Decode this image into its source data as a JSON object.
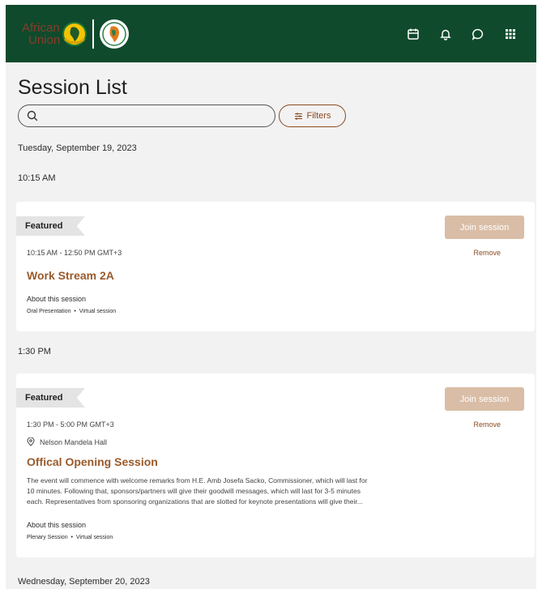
{
  "header": {
    "logo_text_line1": "African",
    "logo_text_line2": "Union",
    "icons": [
      "calendar-icon",
      "bell-icon",
      "chat-icon",
      "apps-grid-icon"
    ]
  },
  "page": {
    "title": "Session List",
    "search_placeholder": "",
    "filters_label": "Filters"
  },
  "days": [
    {
      "date": "Tuesday, September 19, 2023",
      "slots": [
        {
          "time": "10:15 AM",
          "session": {
            "badge": "Featured",
            "join_label": "Join session",
            "remove_label": "Remove",
            "time_range": "10:15 AM - 12:50 PM GMT+3",
            "location": "",
            "title": "Work Stream 2A",
            "description": "",
            "about_label": "About this session",
            "tags": [
              "Oral Presentation",
              "Virtual session"
            ]
          }
        },
        {
          "time": "1:30 PM",
          "session": {
            "badge": "Featured",
            "join_label": "Join session",
            "remove_label": "Remove",
            "time_range": "1:30 PM - 5:00 PM GMT+3",
            "location": "Nelson Mandela Hall",
            "title": "Offical Opening Session",
            "description_lines": [
              "The event will commence with welcome remarks from H.E. Amb Josefa Sacko, Commissioner, which will last for",
              "10 minutes. Following that, sponsors/partners will give their goodwill messages, which will last for 3-5 minutes",
              "each. Representatives from sponsoring organizations that are slotted for keynote presentations will give their..."
            ],
            "about_label": "About this session",
            "tags": [
              "Plenary Session",
              "Virtual session"
            ]
          }
        }
      ]
    },
    {
      "date": "Wednesday, September 20, 2023"
    }
  ],
  "colors": {
    "header_bg": "#0f4a2c",
    "accent": "#9a5a2a",
    "join_button": "#d9bda6",
    "page_bg": "#f2f2f2"
  }
}
